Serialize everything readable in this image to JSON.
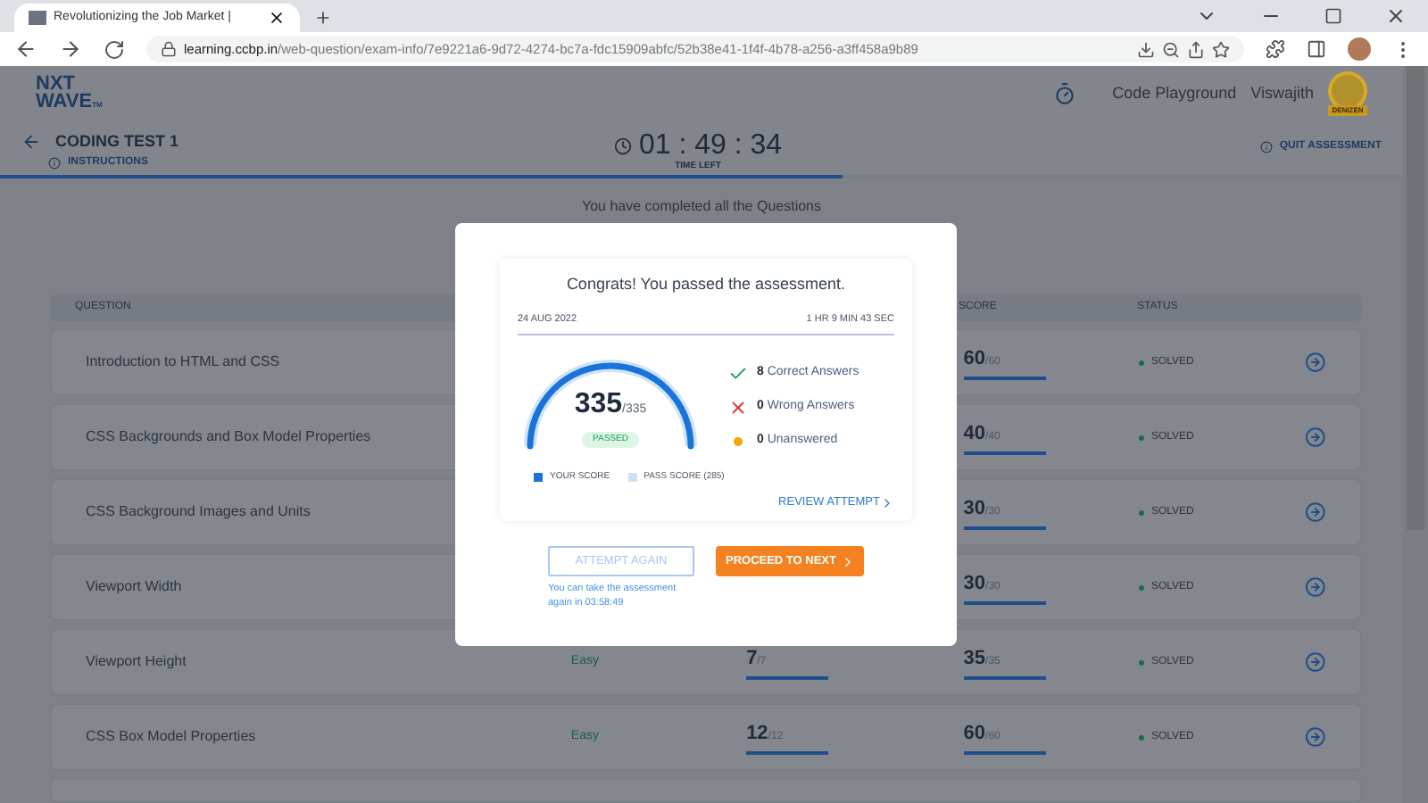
{
  "browser": {
    "tab_title": "Revolutionizing the Job Market |",
    "url_host": "learning.ccbp.in",
    "url_path": "/web-question/exam-info/7e9221a6-9d72-4274-bc7a-fdc15909abfc/52b38e41-1f4f-4b78-a256-a3ff458a9b89"
  },
  "nav": {
    "logo_top": "NXT",
    "logo_bottom": "WAVE",
    "logo_suffix": "TM",
    "links": [
      "Code Playground"
    ],
    "user": "Viswajith",
    "badge": "DENIZEN"
  },
  "test_bar": {
    "title": "CODING TEST 1",
    "instructions": "INSTRUCTIONS",
    "timer": "01 : 49 : 34",
    "timer_label": "TIME LEFT",
    "quit": "QUIT ASSESSMENT",
    "progress": {
      "level": 0.6
    }
  },
  "completed_message": "You have completed all the Questions",
  "table": {
    "columns": [
      "QUESTION",
      "SCORE",
      "STATUS"
    ],
    "rows": [
      {
        "question": "Introduction to HTML and CSS",
        "score": "60",
        "score_max": "/60",
        "level": 1,
        "status": "SOLVED"
      },
      {
        "question": "CSS Backgrounds and Box Model Properties",
        "score": "40",
        "score_max": "/40",
        "level": 1,
        "status": "SOLVED"
      },
      {
        "question": "CSS Background Images and Units",
        "score": "30",
        "score_max": "/30",
        "level": 1,
        "status": "SOLVED"
      },
      {
        "question": "Viewport Width",
        "score": "30",
        "score_max": "/30",
        "level": 1,
        "status": "SOLVED"
      },
      {
        "question": "Viewport Height",
        "difficulty": "Easy",
        "column_3": {
          "value": "7",
          "max": "/7",
          "level": 1
        },
        "score": "35",
        "score_max": "/35",
        "level": 1,
        "status": "SOLVED"
      },
      {
        "question": "CSS Box Model Properties",
        "difficulty": "Easy",
        "column_3": {
          "value": "12",
          "max": "/12",
          "level": 1
        },
        "score": "60",
        "score_max": "/60",
        "level": 1,
        "status": "SOLVED"
      }
    ]
  },
  "dialog": {
    "title": "Congrats! You passed the assessment.",
    "date": "24 AUG 2022",
    "duration": "1 HR 9 MIN 43 SEC",
    "gauge": {
      "score": "335",
      "max": "/335",
      "level": 1,
      "badge": "PASSED"
    },
    "stats": [
      {
        "kind": "correct",
        "count": "8",
        "label": "Correct Answers"
      },
      {
        "kind": "wrong",
        "count": "0",
        "label": "Wrong Answers"
      },
      {
        "kind": "unanswered",
        "count": "0",
        "label": "Unanswered"
      }
    ],
    "legend": [
      {
        "label": "YOUR SCORE",
        "color": "#1a73d9"
      },
      {
        "label": "PASS SCORE (285)",
        "color": "#cfe0f5"
      }
    ],
    "review": "REVIEW ATTEMPT",
    "attempt_again": {
      "label": "ATTEMPT AGAIN",
      "disabled": true
    },
    "proceed": "PROCEED TO NEXT",
    "note": "You can take the assessment again in 03:58:49"
  }
}
